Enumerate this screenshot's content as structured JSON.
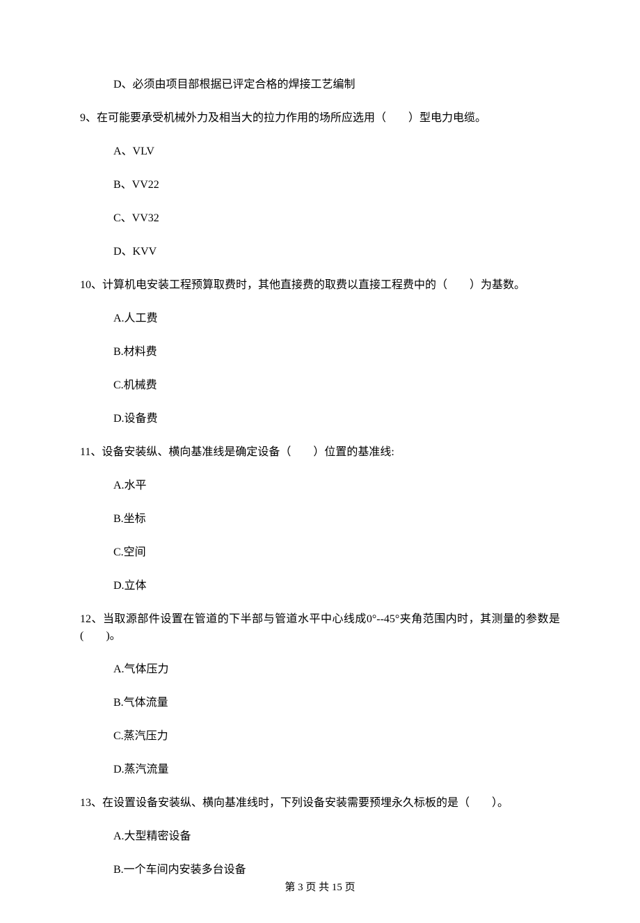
{
  "items": [
    {
      "type": "option",
      "text": "D、必须由项目部根据已评定合格的焊接工艺编制"
    },
    {
      "type": "question",
      "text": "9、在可能要承受机械外力及相当大的拉力作用的场所应选用（　　）型电力电缆。"
    },
    {
      "type": "option",
      "text": "A、VLV"
    },
    {
      "type": "option",
      "text": "B、VV22"
    },
    {
      "type": "option",
      "text": "C、VV32"
    },
    {
      "type": "option",
      "text": "D、KVV"
    },
    {
      "type": "question",
      "text": "10、计算机电安装工程预算取费时，其他直接费的取费以直接工程费中的（　　）为基数。"
    },
    {
      "type": "option",
      "text": "A.人工费"
    },
    {
      "type": "option",
      "text": "B.材料费"
    },
    {
      "type": "option",
      "text": "C.机械费"
    },
    {
      "type": "option",
      "text": "D.设备费"
    },
    {
      "type": "question",
      "text": "11、设备安装纵、横向基准线是确定设备（　　）位置的基准线:"
    },
    {
      "type": "option",
      "text": "A.水平"
    },
    {
      "type": "option",
      "text": "B.坐标"
    },
    {
      "type": "option",
      "text": "C.空间"
    },
    {
      "type": "option",
      "text": "D.立体"
    },
    {
      "type": "question",
      "text": "12、当取源部件设置在管道的下半部与管道水平中心线成0°--45°夹角范围内时，其测量的参数是(　　)。"
    },
    {
      "type": "option",
      "text": "A.气体压力"
    },
    {
      "type": "option",
      "text": "B.气体流量"
    },
    {
      "type": "option",
      "text": "C.蒸汽压力"
    },
    {
      "type": "option",
      "text": "D.蒸汽流量"
    },
    {
      "type": "question",
      "text": "13、在设置设备安装纵、横向基准线时，下列设备安装需要预埋永久标板的是（　　）。"
    },
    {
      "type": "option",
      "text": "A.大型精密设备"
    },
    {
      "type": "option",
      "text": "B.一个车间内安装多台设备"
    }
  ],
  "footer": "第 3 页 共 15 页"
}
